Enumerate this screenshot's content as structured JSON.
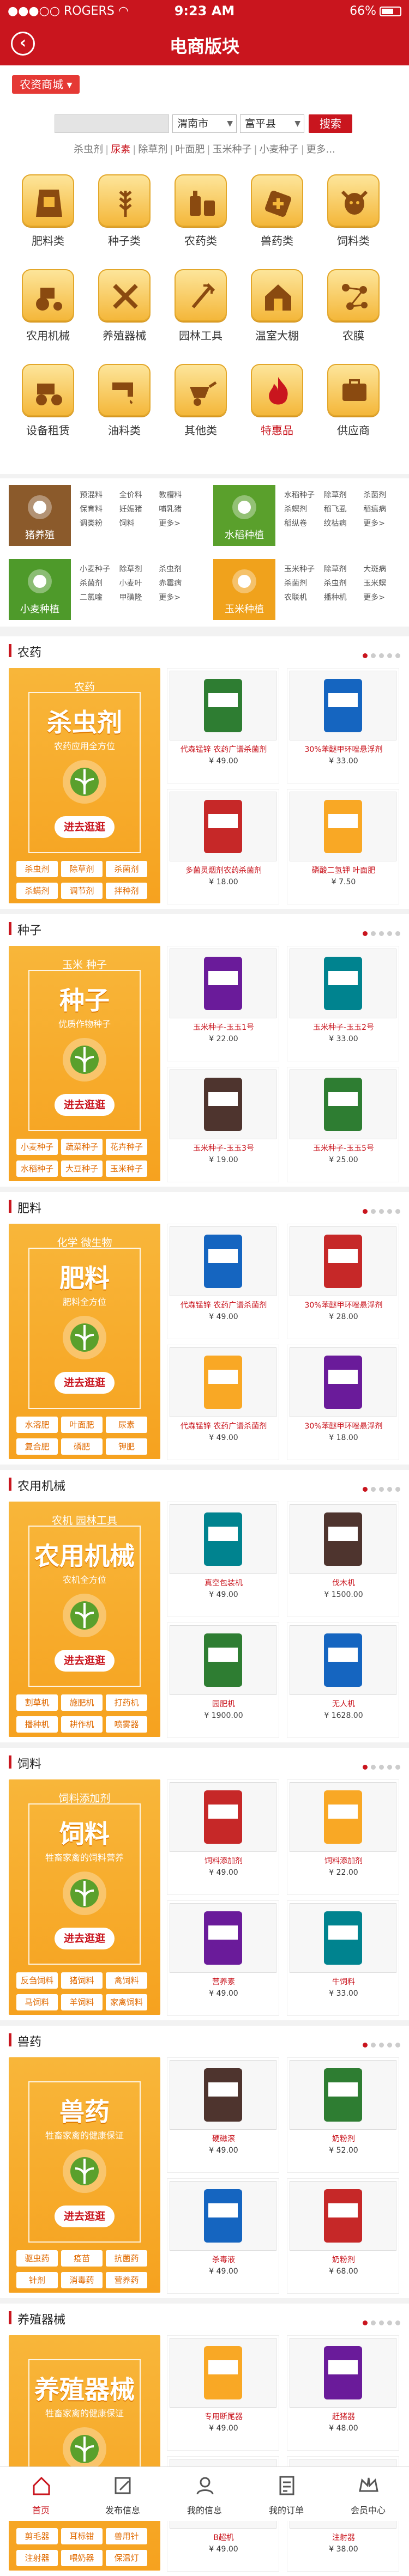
{
  "status": {
    "carrier": "ROGERS",
    "time": "9:23 AM",
    "battery": "66%"
  },
  "nav": {
    "title": "电商版块"
  },
  "mall_tag": "农资商城",
  "search": {
    "city": "渭南市",
    "district": "富平县",
    "button": "搜索"
  },
  "hotwords": [
    "杀虫剂",
    "尿素",
    "除草剂",
    "叶面肥",
    "玉米种子",
    "小麦种子",
    "更多..."
  ],
  "hot_active": "尿素",
  "categories": [
    {
      "label": "肥料类",
      "icon": "fertilizer-bag-icon"
    },
    {
      "label": "种子类",
      "icon": "wheat-icon"
    },
    {
      "label": "农药类",
      "icon": "pesticide-bottle-icon"
    },
    {
      "label": "兽药类",
      "icon": "vet-medicine-icon"
    },
    {
      "label": "饲料类",
      "icon": "cow-icon"
    },
    {
      "label": "农用机械",
      "icon": "tractor-icon"
    },
    {
      "label": "养殖器械",
      "icon": "tools-icon"
    },
    {
      "label": "园林工具",
      "icon": "garden-fork-icon"
    },
    {
      "label": "温室大棚",
      "icon": "greenhouse-icon"
    },
    {
      "label": "农膜",
      "icon": "network-icon"
    },
    {
      "label": "设备租赁",
      "icon": "tractor-rent-icon"
    },
    {
      "label": "油料类",
      "icon": "oil-tap-icon"
    },
    {
      "label": "其他类",
      "icon": "wheelbarrow-icon"
    },
    {
      "label": "特惠品",
      "icon": "fire-sale-icon",
      "hot": true
    },
    {
      "label": "供应商",
      "icon": "supplier-icon"
    }
  ],
  "features": [
    {
      "title": "猪养殖",
      "color": "#8b5a2b",
      "icon": "pig-icon",
      "items": [
        "预混料",
        "全价料",
        "教槽料",
        "保育料",
        "妊娠猪",
        "哺乳猪",
        "调类粉",
        "饲料",
        "更多>"
      ]
    },
    {
      "title": "水稻种植",
      "color": "#5aa02c",
      "icon": "rice-icon",
      "items": [
        "水稻种子",
        "除草剂",
        "杀菌剂",
        "杀螟剂",
        "稻飞虱",
        "稻瘟病",
        "稻纵卷",
        "纹枯病",
        "更多>"
      ]
    },
    {
      "title": "小麦种植",
      "color": "#4e9a2a",
      "icon": "wheat-plant-icon",
      "items": [
        "小麦种子",
        "除草剂",
        "杀虫剂",
        "杀菌剂",
        "小麦叶",
        "赤霉病",
        "二氯喹",
        "甲磺隆",
        "更多>"
      ]
    },
    {
      "title": "玉米种植",
      "color": "#f0a21c",
      "icon": "corn-icon",
      "items": [
        "玉米种子",
        "除草剂",
        "大斑病",
        "杀菌剂",
        "杀虫剂",
        "玉米螟",
        "农联机",
        "播种机",
        "更多>"
      ]
    }
  ],
  "sections": [
    {
      "title": "农药",
      "promo": {
        "sub1": "农药",
        "big": "杀虫剂",
        "sub2": "农药应用全方位",
        "go": "进去逛逛",
        "tags": [
          "杀虫剂",
          "除草剂",
          "杀菌剂",
          "杀螨剂",
          "调节剂",
          "拌种剂"
        ]
      },
      "products": [
        {
          "name": "代森锰锌 农药广谱杀菌剂",
          "price": "¥ 49.00"
        },
        {
          "name": "30%苯醚甲环唑悬浮剂",
          "price": "¥ 33.00"
        },
        {
          "name": "多菌灵烟剂农药杀菌剂",
          "price": "¥ 18.00"
        },
        {
          "name": "磷酸二氢钾 叶面肥",
          "price": "¥ 7.50"
        }
      ]
    },
    {
      "title": "种子",
      "promo": {
        "sub1": "玉米  种子",
        "big": "种子",
        "sub2": "优质作物种子",
        "go": "进去逛逛",
        "tags": [
          "小麦种子",
          "蔬菜种子",
          "花卉种子",
          "水稻种子",
          "大豆种子",
          "玉米种子"
        ]
      },
      "products": [
        {
          "name": "玉米种子-玉玉1号",
          "price": "¥ 22.00"
        },
        {
          "name": "玉米种子-玉玉2号",
          "price": "¥ 33.00"
        },
        {
          "name": "玉米种子-玉玉3号",
          "price": "¥ 19.00"
        },
        {
          "name": "玉米种子-玉玉5号",
          "price": "¥ 25.00"
        }
      ]
    },
    {
      "title": "肥料",
      "promo": {
        "sub1": "化学 微生物",
        "big": "肥料",
        "sub2": "肥料全方位",
        "go": "进去逛逛",
        "tags": [
          "水溶肥",
          "叶面肥",
          "尿素",
          "复合肥",
          "磷肥",
          "钾肥"
        ]
      },
      "products": [
        {
          "name": "代森锰锌 农药广谱杀菌剂",
          "price": "¥ 49.00"
        },
        {
          "name": "30%苯醚甲环唑悬浮剂",
          "price": "¥ 28.00"
        },
        {
          "name": "代森锰锌 农药广谱杀菌剂",
          "price": "¥ 49.00"
        },
        {
          "name": "30%苯醚甲环唑悬浮剂",
          "price": "¥ 18.00"
        }
      ]
    },
    {
      "title": "农用机械",
      "promo": {
        "sub1": "农机  园林工具",
        "big": "农用机械",
        "sub2": "农机全方位",
        "go": "进去逛逛",
        "tags": [
          "割草机",
          "施肥机",
          "打药机",
          "播种机",
          "耕作机",
          "喷雾器"
        ]
      },
      "products": [
        {
          "name": "真空包装机",
          "price": "¥ 49.00"
        },
        {
          "name": "伐木机",
          "price": "¥ 1500.00"
        },
        {
          "name": "园肥机",
          "price": "¥ 1900.00"
        },
        {
          "name": "无人机",
          "price": "¥ 1628.00"
        }
      ]
    },
    {
      "title": "饲料",
      "promo": {
        "sub1": "饲料添加剂",
        "big": "饲料",
        "sub2": "牲畜家禽的饲料营养",
        "go": "进去逛逛",
        "tags": [
          "反刍饲料",
          "猪饲料",
          "禽饲料",
          "马饲料",
          "羊饲料",
          "家禽饲料"
        ]
      },
      "products": [
        {
          "name": "饲料添加剂",
          "price": "¥ 49.00"
        },
        {
          "name": "饲料添加剂",
          "price": "¥ 22.00"
        },
        {
          "name": "营养素",
          "price": "¥ 49.00"
        },
        {
          "name": "牛饲料",
          "price": "¥ 33.00"
        }
      ]
    },
    {
      "title": "兽药",
      "promo": {
        "sub1": "",
        "big": "兽药",
        "sub2": "牲畜家禽的健康保证",
        "go": "进去逛逛",
        "tags": [
          "驱虫药",
          "疫苗",
          "抗菌药",
          "针剂",
          "消毒药",
          "营养药"
        ]
      },
      "products": [
        {
          "name": "硬磁滚",
          "price": "¥ 49.00"
        },
        {
          "name": "奶粉剂",
          "price": "¥ 52.00"
        },
        {
          "name": "杀毒液",
          "price": "¥ 49.00"
        },
        {
          "name": "奶粉剂",
          "price": "¥ 68.00"
        }
      ]
    },
    {
      "title": "养殖器械",
      "promo": {
        "sub1": "",
        "big": "养殖器械",
        "sub2": "牲畜家禽的健康保证",
        "go": "进去逛逛",
        "tags": [
          "剪毛器",
          "耳标钳",
          "兽用针",
          "注射器",
          "喂奶器",
          "保温灯"
        ]
      },
      "products": [
        {
          "name": "专用断尾器",
          "price": "¥ 49.00"
        },
        {
          "name": "赶猪器",
          "price": "¥ 48.00"
        },
        {
          "name": "B超机",
          "price": "¥ 49.00"
        },
        {
          "name": "注射器",
          "price": "¥ 38.00"
        }
      ]
    }
  ],
  "tabbar": [
    {
      "label": "首页",
      "icon": "home-icon",
      "active": true
    },
    {
      "label": "发布信息",
      "icon": "edit-icon"
    },
    {
      "label": "我的信息",
      "icon": "user-icon"
    },
    {
      "label": "我的订单",
      "icon": "orders-icon"
    },
    {
      "label": "会员中心",
      "icon": "crown-icon"
    }
  ],
  "colors": {
    "brand": "#c9151e",
    "promo": "#f6a21f",
    "tile": "#f4b73a"
  }
}
